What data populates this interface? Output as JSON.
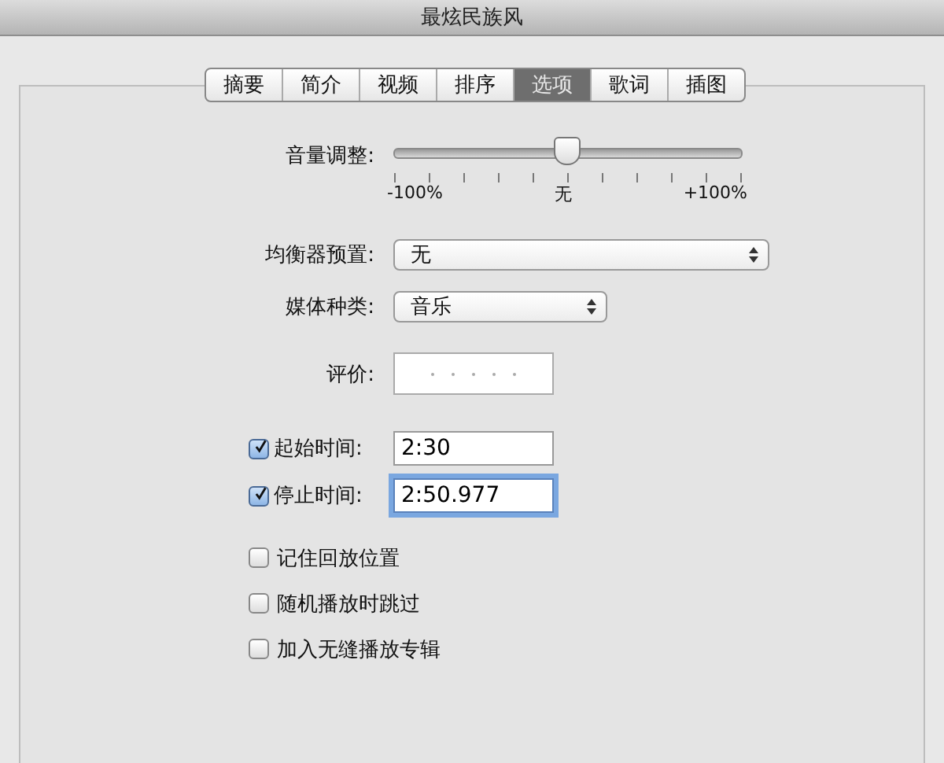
{
  "window": {
    "title": "最炫民族风"
  },
  "tabs": [
    {
      "label": "摘要",
      "selected": false
    },
    {
      "label": "简介",
      "selected": false
    },
    {
      "label": "视频",
      "selected": false
    },
    {
      "label": "排序",
      "selected": false
    },
    {
      "label": "选项",
      "selected": true
    },
    {
      "label": "歌词",
      "selected": false
    },
    {
      "label": "插图",
      "selected": false
    }
  ],
  "volume": {
    "label": "音量调整:",
    "level": 0.5,
    "min_label": "-100%",
    "mid_label": "无",
    "max_label": "+100%"
  },
  "equalizer": {
    "label": "均衡器预置:",
    "value": "无"
  },
  "media_kind": {
    "label": "媒体种类:",
    "value": "音乐"
  },
  "rating": {
    "label": "评价:",
    "stars": 0
  },
  "start_time": {
    "label": "起始时间:",
    "checked": true,
    "value": "2:30",
    "focused": false
  },
  "stop_time": {
    "label": "停止时间:",
    "checked": true,
    "value": "2:50.977",
    "focused": true
  },
  "options": [
    {
      "label": "记住回放位置",
      "checked": false
    },
    {
      "label": "随机播放时跳过",
      "checked": false
    },
    {
      "label": "加入无缝播放专辑",
      "checked": false
    }
  ]
}
